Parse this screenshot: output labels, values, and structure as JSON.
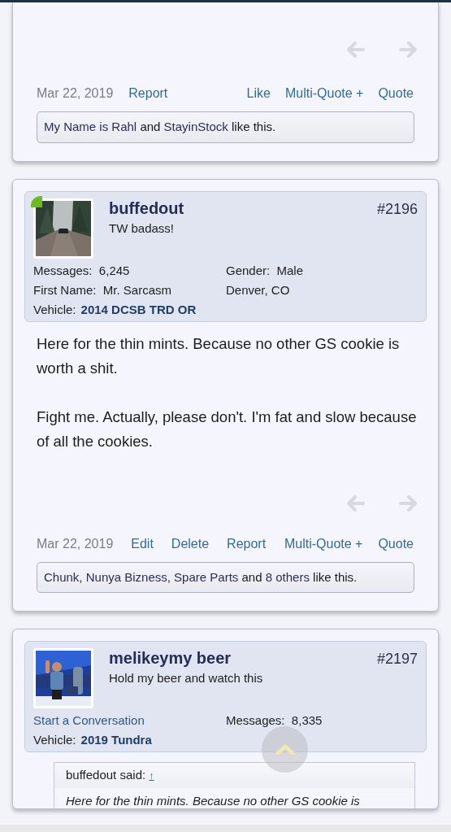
{
  "posts": [
    {
      "show_nav": true,
      "actions_left": [
        {
          "kind": "date",
          "label": "Mar 22, 2019"
        },
        {
          "kind": "link",
          "label": "Report"
        }
      ],
      "actions_right": [
        {
          "kind": "link",
          "label": "Like"
        },
        {
          "kind": "link",
          "label": "Multi-Quote +"
        },
        {
          "kind": "link",
          "label": "Quote"
        }
      ],
      "likes": [
        {
          "kind": "user",
          "text": "My Name is Rahl"
        },
        {
          "kind": "text",
          "text": "and"
        },
        {
          "kind": "user",
          "text": "StayinStock"
        },
        {
          "kind": "text",
          "text": "like this."
        }
      ]
    },
    {
      "author": {
        "username": "buffedout",
        "title": "TW badass!",
        "online": true
      },
      "post_number": "#2196",
      "stats_left": [
        {
          "kind": "field",
          "label": "Messages:",
          "value": "6,245"
        },
        {
          "kind": "field",
          "label": "First Name:",
          "value": "Mr. Sarcasm"
        },
        {
          "kind": "vehicle",
          "label": "Vehicle:",
          "value": "2014 DCSB TRD OR"
        }
      ],
      "stats_right": [
        {
          "kind": "field",
          "label": "Gender:",
          "value": "Male"
        },
        {
          "kind": "plain",
          "value": "Denver, CO"
        }
      ],
      "body": [
        "Here for the thin mints. Because no other GS cookie is worth a shit.",
        "Fight me. Actually, please don't. I'm fat and slow because of all the cookies."
      ],
      "show_nav": true,
      "actions_left": [
        {
          "kind": "date",
          "label": "Mar 22, 2019"
        },
        {
          "kind": "link",
          "label": "Edit"
        },
        {
          "kind": "link",
          "label": "Delete"
        },
        {
          "kind": "link",
          "label": "Report"
        }
      ],
      "actions_right": [
        {
          "kind": "link",
          "label": "Multi-Quote +"
        },
        {
          "kind": "link",
          "label": "Quote"
        }
      ],
      "likes": [
        {
          "kind": "user",
          "text": "Chunk,"
        },
        {
          "kind": "user",
          "text": "Nunya Bizness,"
        },
        {
          "kind": "user",
          "text": "Spare Parts"
        },
        {
          "kind": "text",
          "text": "and"
        },
        {
          "kind": "user",
          "text": "8 others"
        },
        {
          "kind": "text",
          "text": "like this."
        }
      ]
    },
    {
      "author": {
        "username": "melikeymy beer",
        "title": "Hold my beer and watch this",
        "online": false
      },
      "post_number": "#2197",
      "stats_left": [
        {
          "kind": "link",
          "value": "Start a Conversation"
        },
        {
          "kind": "vehicle",
          "label": "Vehicle:",
          "value": "2019 Tundra"
        }
      ],
      "stats_right": [
        {
          "kind": "field",
          "label": "Messages:",
          "value": "8,335"
        }
      ],
      "quote": {
        "author": "buffedout said:",
        "jump": "↑",
        "text": "Here for the thin mints. Because no other GS cookie is"
      }
    }
  ],
  "scroll_top_button": true
}
